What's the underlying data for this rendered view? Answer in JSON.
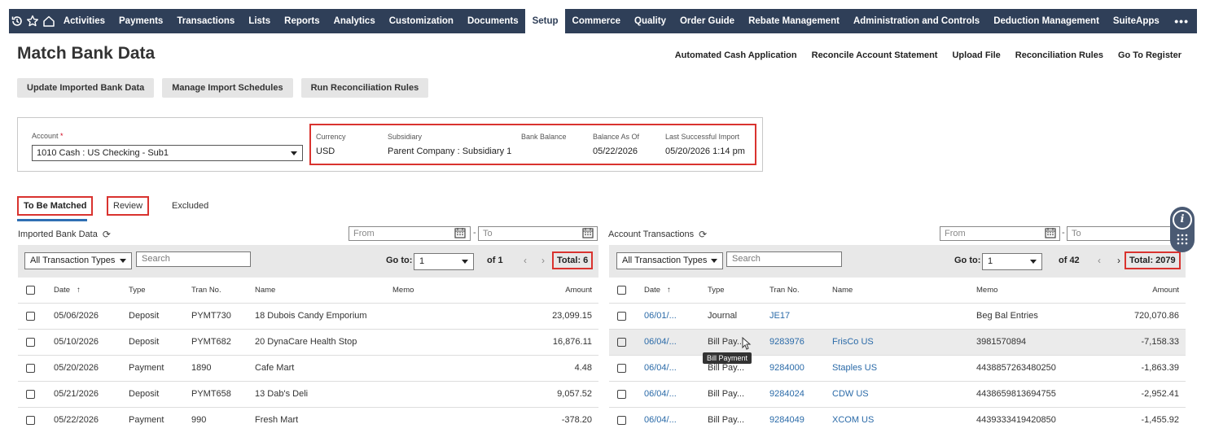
{
  "nav": {
    "items": [
      "Activities",
      "Payments",
      "Transactions",
      "Lists",
      "Reports",
      "Analytics",
      "Customization",
      "Documents",
      "Setup",
      "Commerce",
      "Quality",
      "Order Guide",
      "Rebate Management",
      "Administration and Controls",
      "Deduction Management",
      "SuiteApps"
    ],
    "active": "Setup",
    "more": "•••"
  },
  "page": {
    "title": "Match Bank Data",
    "header_links": [
      "Automated Cash Application",
      "Reconcile Account Statement",
      "Upload File",
      "Reconciliation Rules",
      "Go To Register"
    ],
    "buttons": [
      "Update Imported Bank Data",
      "Manage Import Schedules",
      "Run Reconciliation Rules"
    ]
  },
  "account": {
    "label": "Account",
    "required_mark": "*",
    "value": "1010 Cash : US Checking - Sub1",
    "info": [
      {
        "label": "Currency",
        "value": "USD"
      },
      {
        "label": "Subsidiary",
        "value": "Parent Company : Subsidiary 1"
      },
      {
        "label": "Bank Balance",
        "value": ""
      },
      {
        "label": "Balance As Of",
        "value": "05/22/2026"
      },
      {
        "label": "Last Successful Import",
        "value": "05/20/2026 1:14 pm"
      }
    ]
  },
  "tabs": [
    "To Be Matched",
    "Review",
    "Excluded"
  ],
  "imported": {
    "title": "Imported Bank Data",
    "from_placeholder": "From",
    "to_placeholder": "To",
    "type_filter": "All Transaction Types",
    "search_placeholder": "Search",
    "goto_label": "Go to:",
    "goto_value": "1",
    "of_label": "of 1",
    "total": "Total: 6",
    "columns": [
      "Date",
      "Type",
      "Tran No.",
      "Name",
      "Memo",
      "Amount"
    ],
    "sort_arrow": "↑",
    "rows": [
      [
        "05/06/2026",
        "Deposit",
        "PYMT730",
        "18 Dubois Candy Emporium",
        "",
        "23,099.15"
      ],
      [
        "05/10/2026",
        "Deposit",
        "PYMT682",
        "20 DynaCare Health Stop",
        "",
        "16,876.11"
      ],
      [
        "05/20/2026",
        "Payment",
        "1890",
        "Cafe Mart",
        "",
        "4.48"
      ],
      [
        "05/21/2026",
        "Deposit",
        "PYMT658",
        "13 Dab's Deli",
        "",
        "9,057.52"
      ],
      [
        "05/22/2026",
        "Payment",
        "990",
        "Fresh Mart",
        "",
        "-378.20"
      ]
    ]
  },
  "account_tx": {
    "title": "Account Transactions",
    "from_placeholder": "From",
    "to_placeholder": "To",
    "type_filter": "All Transaction Types",
    "search_placeholder": "Search",
    "goto_label": "Go to:",
    "goto_value": "1",
    "of_label": "of 42",
    "total": "Total: 2079",
    "columns": [
      "Date",
      "Type",
      "Tran No.",
      "Name",
      "Memo",
      "Amount"
    ],
    "sort_arrow": "↑",
    "rows": [
      [
        "06/01/...",
        "Journal",
        "JE17",
        "",
        "Beg Bal Entries",
        "720,070.86"
      ],
      [
        "06/04/...",
        "Bill Pay...",
        "9283976",
        "FrisCo US",
        "3981570894",
        "-7,158.33"
      ],
      [
        "06/04/...",
        "Bill Pay...",
        "9284000",
        "Staples US",
        "4438857263480250",
        "-1,863.39"
      ],
      [
        "06/04/...",
        "Bill Pay...",
        "9284024",
        "CDW US",
        "4438659813694755",
        "-2,952.41"
      ],
      [
        "06/04/...",
        "Bill Pay...",
        "9284049",
        "XCOM US",
        "4439333419420850",
        "-1,455.92"
      ]
    ],
    "tooltip": "Bill Payment"
  }
}
